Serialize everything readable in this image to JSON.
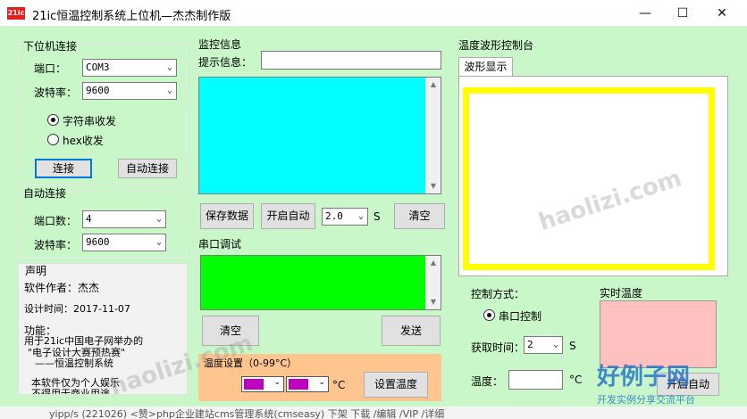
{
  "window": {
    "title": "21ic恒温控制系统上位机—杰杰制作版",
    "logo_text": "21ic"
  },
  "lower_conn": {
    "title": "下位机连接",
    "port_label": "端口：",
    "port_value": "COM3",
    "baud_label": "波特率：",
    "baud_value": "9600",
    "mode_string": "字符串收发",
    "mode_hex": "hex收发",
    "connect_btn": "连接",
    "auto_connect_btn": "自动连接"
  },
  "auto_conn": {
    "title": "自动连接",
    "ports_label": "端口数：",
    "ports_value": "4",
    "baud_label": "波特率：",
    "baud_value": "9600"
  },
  "declaration": {
    "title": "声明",
    "author": "软件作者：杰杰",
    "date": "设计时间：2017-11-07",
    "func_title": "功能：",
    "func_line1": "用于21ic中国电子网举办的",
    "func_line2": "\"电子设计大赛预热赛\"",
    "func_line3": "——恒温控制系统",
    "note_line1": "本软件仅为个人娱乐",
    "note_line2": "不得用于商业用途"
  },
  "monitor": {
    "title": "监控信息",
    "hint_label": "提示信息：",
    "save_btn": "保存数据",
    "auto_btn": "开启自动",
    "interval_value": "2.0",
    "interval_unit": "S",
    "clear_btn": "清空",
    "colors": {
      "display": "#00ffff"
    }
  },
  "serial": {
    "title": "串口调试",
    "clear_btn": "清空",
    "send_btn": "发送",
    "colors": {
      "display": "#00ff00"
    }
  },
  "temp_setting": {
    "title": "温度设置（0-99°C）",
    "unit": "°C",
    "set_btn": "设置温度",
    "colors": {
      "panel": "#ffc58f",
      "swatch": "#c000c0"
    }
  },
  "waveform": {
    "title": "温度波形控制台",
    "tab": "波形显示",
    "colors": {
      "frame": "#ffff00"
    }
  },
  "control": {
    "mode_label": "控制方式：",
    "mode_serial": "串口控制",
    "interval_label": "获取时间：",
    "interval_value": "2",
    "interval_unit": "S",
    "temp_label": "温度：",
    "temp_unit": "°C",
    "realtime_label": "实时温度",
    "auto_btn": "开启自动",
    "colors": {
      "realtime": "#ffc0c0"
    }
  },
  "watermark": {
    "text": "haolizi.com"
  },
  "brand": {
    "name": "好例子网",
    "sub": "开发实例分享交流平台"
  },
  "background": {
    "snippet": "yipp/s (221026)   <赞>php企业建站cms管理系统(cmseasy)   下架 下载 /编辑 /VIP /详细"
  },
  "colors": {
    "client_bg": "#c9f7c9"
  }
}
